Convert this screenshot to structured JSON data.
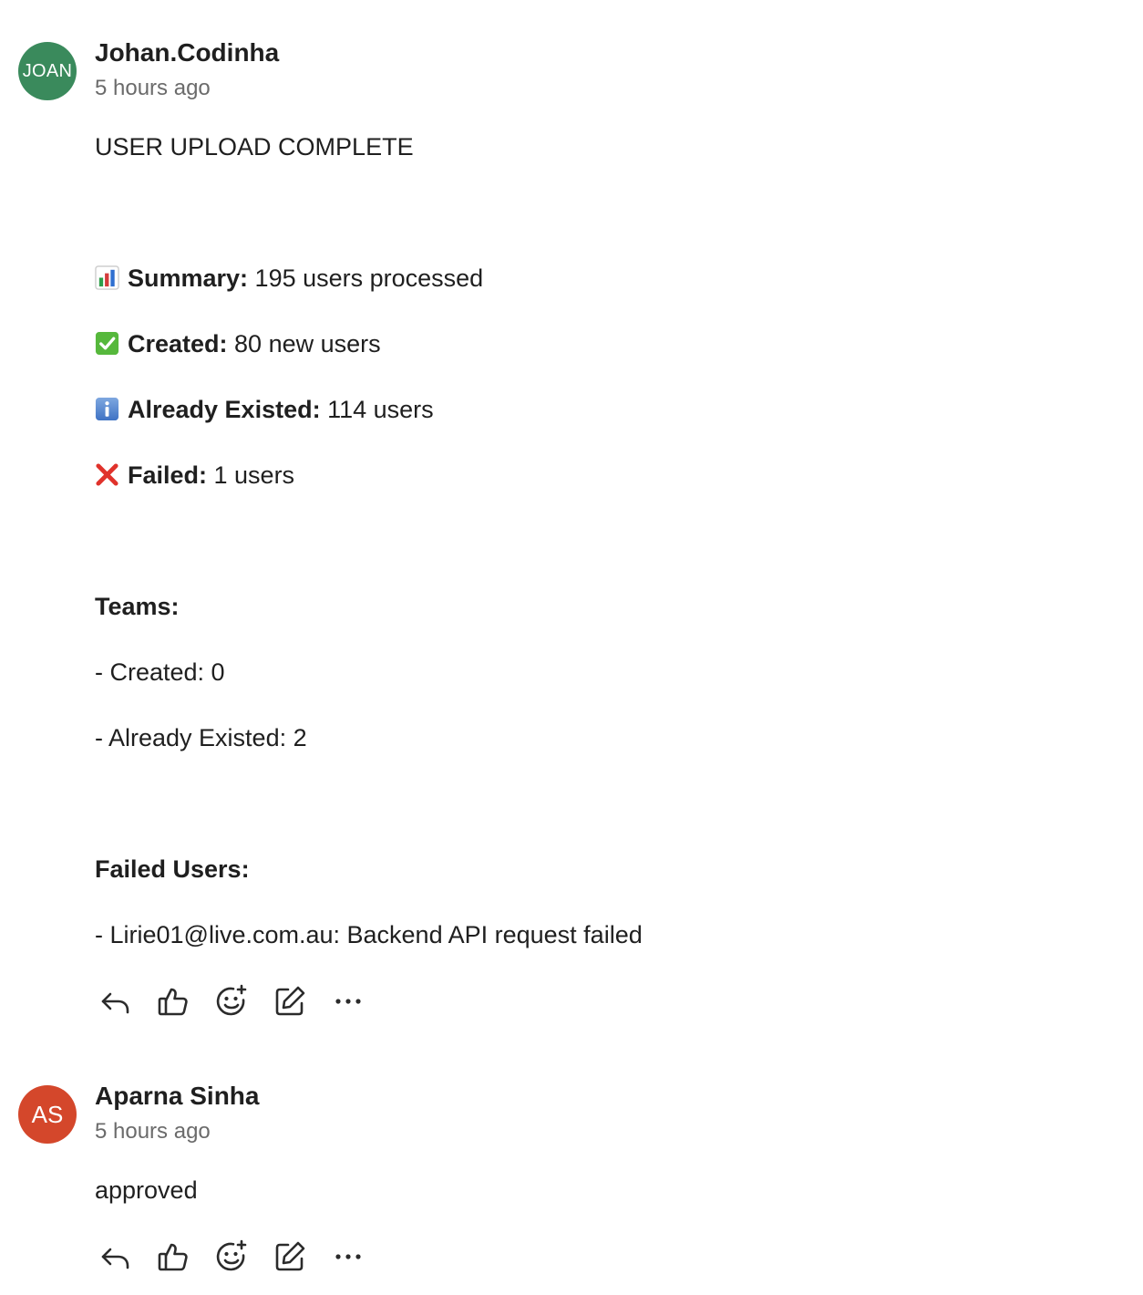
{
  "comments": [
    {
      "avatar_initials": "JOAN",
      "avatar_color": "#3a8a5c",
      "author": "Johan.Codinha",
      "timestamp": "5 hours ago",
      "title": "USER UPLOAD COMPLETE",
      "summary": {
        "icon": "bar-chart-icon",
        "label": "Summary:",
        "value": " 195 users processed"
      },
      "created": {
        "icon": "check-mark-button-icon",
        "label": "Created:",
        "value": " 80 new users"
      },
      "already_existed": {
        "icon": "information-icon",
        "label": "Already Existed:",
        "value": " 114 users"
      },
      "failed": {
        "icon": "cross-mark-icon",
        "label": "Failed:",
        "value": " 1 users"
      },
      "teams_heading": "Teams:",
      "teams_created": "- Created: 0",
      "teams_existed": "- Already Existed: 2",
      "failed_users_heading": "Failed Users:",
      "failed_user_line": "- Lirie01@live.com.au: Backend API request failed"
    },
    {
      "avatar_initials": "AS",
      "avatar_color": "#d4472b",
      "author": "Aparna Sinha",
      "timestamp": "5 hours ago",
      "body": "approved"
    }
  ],
  "actions": [
    "reply-icon",
    "thumbs-up-icon",
    "add-reaction-icon",
    "edit-icon",
    "more-icon"
  ],
  "colors": {
    "text": "#1f1f1f",
    "muted": "#6b6b6b",
    "icon": "#2b2b2b"
  }
}
